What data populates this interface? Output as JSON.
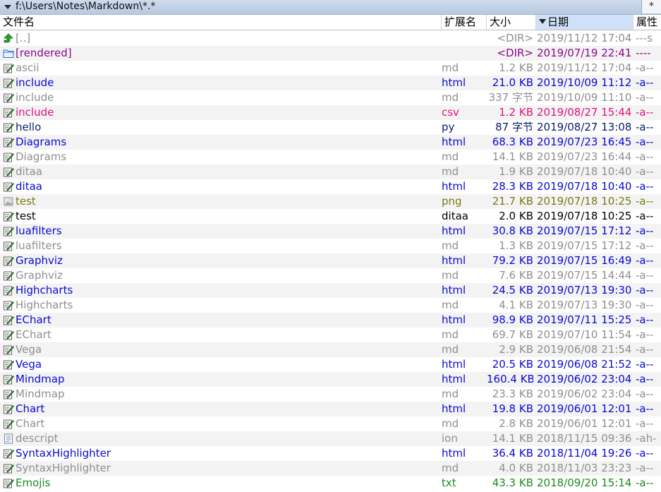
{
  "path_bar": {
    "path": "f:\\Users\\Notes\\Markdown\\*.*",
    "filter_button": "*"
  },
  "columns": {
    "name": "文件名",
    "ext": "扩展名",
    "size": "大小",
    "date": "日期",
    "attr": "属性"
  },
  "colors": {
    "header_sorted_bg": "#cfe1f8",
    "alt_row_bg": "#f3f3f3",
    "path_bar_bg": "#c3d3e8"
  },
  "files": [
    {
      "name": "[..]",
      "ext": "",
      "size": "<DIR>",
      "date": "2019/11/12 17:04",
      "attr": "---s",
      "color": "gray",
      "icon": "up-arrow-icon"
    },
    {
      "name": "[rendered]",
      "ext": "",
      "size": "<DIR>",
      "date": "2019/07/19 22:41",
      "attr": "----",
      "color": "purple",
      "icon": "folder-icon"
    },
    {
      "name": "ascii",
      "ext": "md",
      "size": "1.2 KB",
      "date": "2019/11/12 17:04",
      "attr": "-a--",
      "color": "gray",
      "icon": "pen-file-icon"
    },
    {
      "name": "include",
      "ext": "html",
      "size": "21.0 KB",
      "date": "2019/10/09 11:12",
      "attr": "-a--",
      "color": "blue",
      "icon": "pen-file-icon"
    },
    {
      "name": "include",
      "ext": "md",
      "size": "337 字节",
      "date": "2019/10/09 11:10",
      "attr": "-a--",
      "color": "gray",
      "icon": "pen-file-icon"
    },
    {
      "name": "include",
      "ext": "csv",
      "size": "1.2 KB",
      "date": "2019/08/27 15:44",
      "attr": "-a--",
      "color": "pink",
      "icon": "pen-file-icon"
    },
    {
      "name": "hello",
      "ext": "py",
      "size": "87 字节",
      "date": "2019/08/27 13:08",
      "attr": "-a--",
      "color": "navy",
      "icon": "pen-file-icon"
    },
    {
      "name": "Diagrams",
      "ext": "html",
      "size": "68.3 KB",
      "date": "2019/07/23 16:45",
      "attr": "-a--",
      "color": "blue",
      "icon": "pen-file-icon"
    },
    {
      "name": "Diagrams",
      "ext": "md",
      "size": "14.1 KB",
      "date": "2019/07/23 16:44",
      "attr": "-a--",
      "color": "gray",
      "icon": "pen-file-icon"
    },
    {
      "name": "ditaa",
      "ext": "md",
      "size": "1.9 KB",
      "date": "2019/07/18 10:40",
      "attr": "-a--",
      "color": "gray",
      "icon": "pen-file-icon"
    },
    {
      "name": "ditaa",
      "ext": "html",
      "size": "28.3 KB",
      "date": "2019/07/18 10:40",
      "attr": "-a--",
      "color": "blue",
      "icon": "pen-file-icon"
    },
    {
      "name": "test",
      "ext": "png",
      "size": "21.7 KB",
      "date": "2019/07/18 10:25",
      "attr": "-a--",
      "color": "olive",
      "icon": "image-file-icon"
    },
    {
      "name": "test",
      "ext": "ditaa",
      "size": "2.0 KB",
      "date": "2019/07/18 10:25",
      "attr": "-a--",
      "color": "black",
      "icon": "pen-file-icon"
    },
    {
      "name": "luafilters",
      "ext": "html",
      "size": "30.8 KB",
      "date": "2019/07/15 17:12",
      "attr": "-a--",
      "color": "blue",
      "icon": "pen-file-icon"
    },
    {
      "name": "luafilters",
      "ext": "md",
      "size": "1.3 KB",
      "date": "2019/07/15 17:12",
      "attr": "-a--",
      "color": "gray",
      "icon": "pen-file-icon"
    },
    {
      "name": "Graphviz",
      "ext": "html",
      "size": "79.2 KB",
      "date": "2019/07/15 16:49",
      "attr": "-a--",
      "color": "blue",
      "icon": "pen-file-icon"
    },
    {
      "name": "Graphviz",
      "ext": "md",
      "size": "7.6 KB",
      "date": "2019/07/15 14:44",
      "attr": "-a--",
      "color": "gray",
      "icon": "pen-file-icon"
    },
    {
      "name": "Highcharts",
      "ext": "html",
      "size": "24.5 KB",
      "date": "2019/07/13 19:30",
      "attr": "-a--",
      "color": "blue",
      "icon": "pen-file-icon"
    },
    {
      "name": "Highcharts",
      "ext": "md",
      "size": "4.1 KB",
      "date": "2019/07/13 19:30",
      "attr": "-a--",
      "color": "gray",
      "icon": "pen-file-icon"
    },
    {
      "name": "EChart",
      "ext": "html",
      "size": "98.9 KB",
      "date": "2019/07/11 15:25",
      "attr": "-a--",
      "color": "blue",
      "icon": "pen-file-icon"
    },
    {
      "name": "EChart",
      "ext": "md",
      "size": "69.7 KB",
      "date": "2019/07/10 11:54",
      "attr": "-a--",
      "color": "gray",
      "icon": "pen-file-icon"
    },
    {
      "name": "Vega",
      "ext": "md",
      "size": "2.9 KB",
      "date": "2019/06/08 21:54",
      "attr": "-a--",
      "color": "gray",
      "icon": "pen-file-icon"
    },
    {
      "name": "Vega",
      "ext": "html",
      "size": "20.5 KB",
      "date": "2019/06/08 21:52",
      "attr": "-a--",
      "color": "blue",
      "icon": "pen-file-icon"
    },
    {
      "name": "Mindmap",
      "ext": "html",
      "size": "160.4 KB",
      "date": "2019/06/02 23:04",
      "attr": "-a--",
      "color": "blue",
      "icon": "pen-file-icon"
    },
    {
      "name": "Mindmap",
      "ext": "md",
      "size": "23.3 KB",
      "date": "2019/06/02 23:04",
      "attr": "-a--",
      "color": "gray",
      "icon": "pen-file-icon"
    },
    {
      "name": "Chart",
      "ext": "html",
      "size": "19.8 KB",
      "date": "2019/06/01 12:01",
      "attr": "-a--",
      "color": "blue",
      "icon": "pen-file-icon"
    },
    {
      "name": "Chart",
      "ext": "md",
      "size": "2.8 KB",
      "date": "2019/06/01 12:01",
      "attr": "-a--",
      "color": "gray",
      "icon": "pen-file-icon"
    },
    {
      "name": "descript",
      "ext": "ion",
      "size": "14.1 KB",
      "date": "2018/11/15 09:36",
      "attr": "-ah-",
      "color": "gray",
      "icon": "text-file-icon"
    },
    {
      "name": "SyntaxHighlighter",
      "ext": "html",
      "size": "36.4 KB",
      "date": "2018/11/04 19:26",
      "attr": "-a--",
      "color": "blue",
      "icon": "pen-file-icon"
    },
    {
      "name": "SyntaxHighlighter",
      "ext": "md",
      "size": "4.0 KB",
      "date": "2018/11/03 23:23",
      "attr": "-a--",
      "color": "gray",
      "icon": "pen-file-icon"
    },
    {
      "name": "Emojis",
      "ext": "txt",
      "size": "43.3 KB",
      "date": "2018/09/20 15:14",
      "attr": "-a--",
      "color": "green",
      "icon": "pen-file-icon"
    }
  ]
}
